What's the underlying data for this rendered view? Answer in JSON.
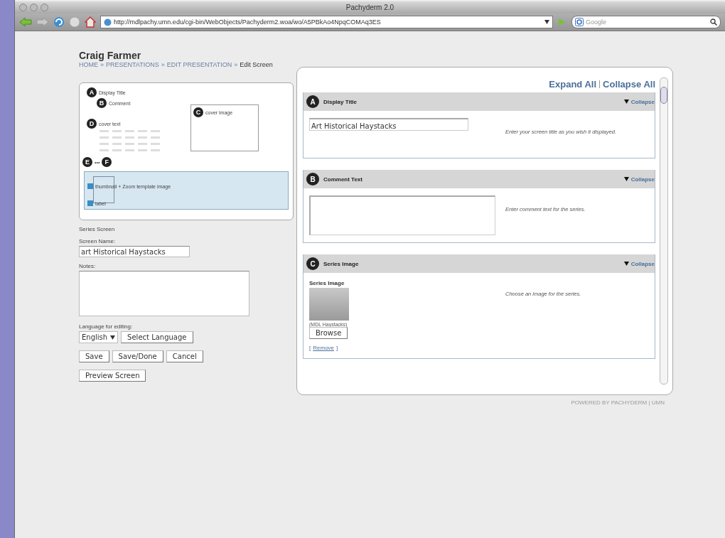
{
  "window": {
    "title": "Pachyderm 2.0"
  },
  "toolbar": {
    "url": "http://mdlpachy.umn.edu/cgi-bin/WebObjects/Pachyderm2.woa/wo/A5PBkAo4NpqCOMAq3ES",
    "search_placeholder": "Google"
  },
  "header": {
    "user": "Craig Farmer",
    "breadcrumb": [
      {
        "label": "HOME",
        "link": true
      },
      {
        "label": "PRESENTATIONS",
        "link": true
      },
      {
        "label": "EDIT PRESENTATION",
        "link": true
      },
      {
        "label": "Edit Screen",
        "link": false
      }
    ],
    "separator": "»"
  },
  "template": {
    "items": [
      {
        "kind": "text",
        "marker": "A",
        "label": "Display Title"
      },
      {
        "kind": "text",
        "marker": "B",
        "label": "Comment"
      },
      {
        "kind": "grid",
        "marker": "D",
        "label": "cover text"
      },
      {
        "kind": "frame",
        "marker": "C",
        "label": "cover image"
      },
      {
        "kind": "range",
        "marker": "E",
        "label": "•••",
        "marker2": "F"
      },
      {
        "kind": "strip",
        "label": "thumbnail + Zoom template image",
        "sublabel": "label"
      }
    ]
  },
  "form": {
    "template_name": "Series Screen",
    "screen_name_label": "Screen Name:",
    "screen_name": "art Historical Haystacks",
    "notes_label": "Notes:",
    "language_label": "Language for editing:",
    "language": "English",
    "select_language": "Select Language",
    "buttons": [
      "Save",
      "Save/Done",
      "Cancel"
    ],
    "preview": "Preview Screen"
  },
  "editor": {
    "expand_all": "Expand All",
    "collapse_all": "Collapse All",
    "sections": [
      {
        "marker": "A",
        "title": "Display Title",
        "toggle": "Collapse",
        "expanded": true,
        "kind": "input",
        "value": "Art Historical Haystacks",
        "help": "Enter your screen title as you wish it displayed."
      },
      {
        "marker": "B",
        "title": "Comment Text",
        "toggle": "Collapse",
        "expanded": true,
        "kind": "textarea",
        "help": "Enter comment text for the series."
      },
      {
        "marker": "C",
        "title": "Series Image",
        "toggle": "Collapse",
        "expanded": true,
        "kind": "image",
        "field_label": "Series Image",
        "caption": "(MDL Haystacks)",
        "browse": "Browse",
        "remove_open": "[",
        "remove": "Remove",
        "remove_close": "]",
        "help": "Choose an image for the series."
      }
    ]
  },
  "footer": "POWERED BY PACHYDERM | UMN"
}
